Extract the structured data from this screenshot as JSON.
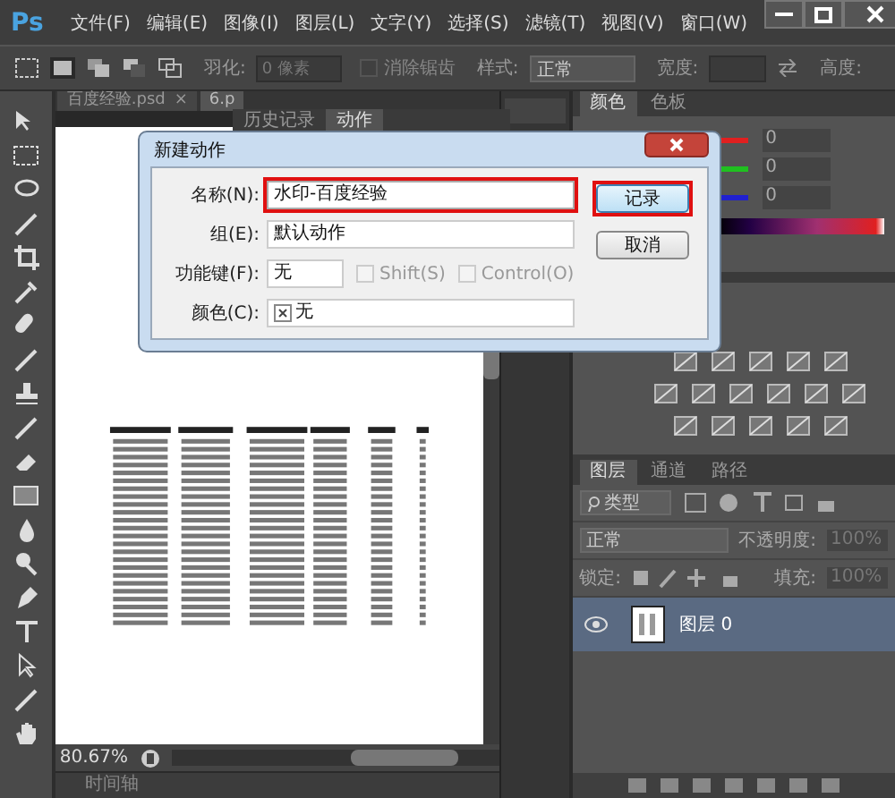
{
  "app": {
    "logo": "Ps"
  },
  "menu": [
    "文件(F)",
    "编辑(E)",
    "图像(I)",
    "图层(L)",
    "文字(Y)",
    "选择(S)",
    "滤镜(T)",
    "视图(V)",
    "窗口(W)"
  ],
  "options": {
    "feather_label": "羽化:",
    "feather_value": "0 像素",
    "antialias": {
      "label": "消除锯齿",
      "checked": false,
      "disabled": true
    },
    "style_label": "样式:",
    "style_value": "正常",
    "width_label": "宽度:",
    "height_label": "高度:"
  },
  "doc_tabs": [
    {
      "label": "百度经验.psd",
      "close": "×",
      "selected": false
    },
    {
      "label": "6.p",
      "selected": true
    }
  ],
  "floating_panel": {
    "tabs": [
      {
        "label": "历史记录",
        "selected": false
      },
      {
        "label": "动作",
        "selected": true
      }
    ]
  },
  "dialog": {
    "title": "新建动作",
    "fields": [
      {
        "kind": "text",
        "label": "名称(N):",
        "value": "水印-百度经验",
        "highlighted": true
      },
      {
        "kind": "select",
        "label": "组(E):",
        "value": "默认动作"
      },
      {
        "kind": "key",
        "label": "功能键(F):",
        "value": "无",
        "checks": [
          {
            "label": "Shift(S)",
            "checked": false,
            "disabled": true
          },
          {
            "label": "Control(O)",
            "checked": false,
            "disabled": true
          }
        ]
      },
      {
        "kind": "color",
        "label": "颜色(C):",
        "value": "无"
      }
    ],
    "buttons": [
      {
        "label": "记录",
        "default": true,
        "highlighted": true
      },
      {
        "label": "取消",
        "default": false,
        "highlighted": false
      }
    ]
  },
  "color_panel": {
    "tabs": [
      {
        "label": "颜色",
        "selected": true
      },
      {
        "label": "色板",
        "selected": false
      }
    ],
    "channels": [
      {
        "color": "#e02020",
        "value": "0"
      },
      {
        "color": "#20c020",
        "value": "0"
      },
      {
        "color": "#2020d0",
        "value": "0"
      }
    ]
  },
  "layers_panel": {
    "tabs": [
      {
        "label": "图层",
        "selected": true
      },
      {
        "label": "通道",
        "selected": false
      },
      {
        "label": "路径",
        "selected": false
      }
    ],
    "filter": "类型",
    "blend": "正常",
    "opacity_label": "不透明度:",
    "opacity": "100%",
    "lock_label": "锁定:",
    "fill_label": "填充:",
    "fill": "100%",
    "layers": [
      {
        "name": "图层 0",
        "visible": true,
        "selected": true
      }
    ]
  },
  "status": {
    "zoom": "80.67%"
  },
  "timeline": {
    "label": "时间轴"
  }
}
